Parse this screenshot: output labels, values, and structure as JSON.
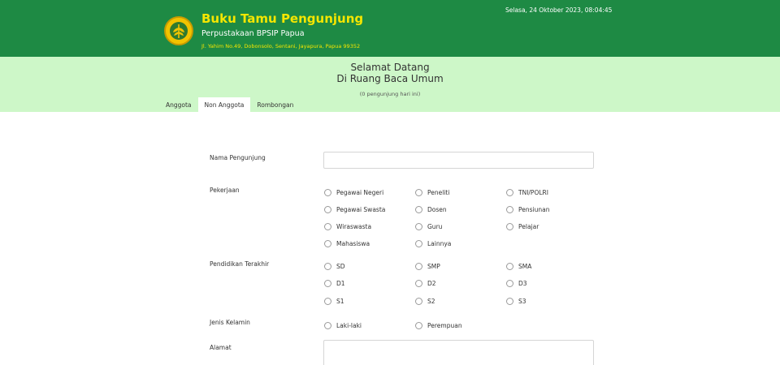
{
  "header": {
    "title": "Buku Tamu Pengunjung",
    "subtitle": "Perpustakaan BPSIP Papua",
    "address": "Jl. Yahim No.49, Dobonsolo, Sentani, Jayapura, Papua 99352",
    "datetime": "Selasa, 24 Oktober 2023, 08:04:45",
    "logo_icon": "wheat-emblem-icon"
  },
  "welcome": {
    "line1": "Selamat Datang",
    "line2": "Di Ruang Baca Umum",
    "visitors": "(0 pengunjung hari ini)"
  },
  "tabs": [
    {
      "label": "Anggota",
      "active": false
    },
    {
      "label": "Non Anggota",
      "active": true
    },
    {
      "label": "Rombongan",
      "active": false
    }
  ],
  "form": {
    "nama_label": "Nama Pengunjung",
    "nama_value": "",
    "pekerjaan_label": "Pekerjaan",
    "pekerjaan_options": [
      "Pegawai Negeri",
      "Peneliti",
      "TNI/POLRI",
      "Pegawai Swasta",
      "Dosen",
      "Pensiunan",
      "Wiraswasta",
      "Guru",
      "Pelajar",
      "Mahasiswa",
      "Lainnya"
    ],
    "pendidikan_label": "Pendidikan Terakhir",
    "pendidikan_options": [
      "SD",
      "SMP",
      "SMA",
      "D1",
      "D2",
      "D3",
      "S1",
      "S2",
      "S3"
    ],
    "kelamin_label": "Jenis Kelamin",
    "kelamin_options": [
      "Laki-laki",
      "Perempuan"
    ],
    "alamat_label": "Alamat",
    "alamat_value": ""
  },
  "colors": {
    "header_green": "#1e8a44",
    "welcome_bg": "#cdf7c8",
    "title_yellow": "#f5e600"
  }
}
